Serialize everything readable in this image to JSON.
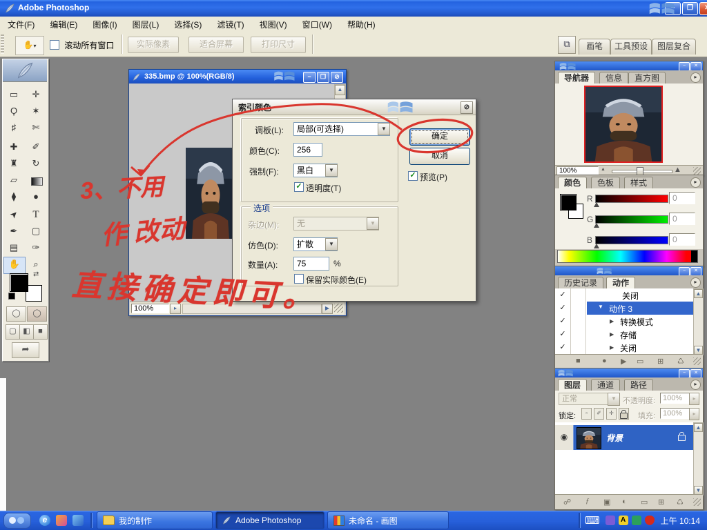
{
  "window": {
    "title": "Adobe Photoshop"
  },
  "menu_bar": {
    "items": [
      "文件(F)",
      "编辑(E)",
      "图像(I)",
      "图层(L)",
      "选择(S)",
      "滤镜(T)",
      "视图(V)",
      "窗口(W)",
      "帮助(H)"
    ]
  },
  "options_bar": {
    "scroll_all_windows_label": "滚动所有窗口",
    "actual_pixels_label": "实际像素",
    "fit_screen_label": "适合屏幕",
    "print_size_label": "打印尺寸",
    "palette_well_tabs": [
      "画笔",
      "工具预设",
      "图层复合"
    ]
  },
  "toolbox": {
    "tools": [
      {
        "name": "rectangular-marquee",
        "glyph": "▭"
      },
      {
        "name": "move",
        "glyph": "✛"
      },
      {
        "name": "lasso",
        "glyph": "Ϙ"
      },
      {
        "name": "magic-wand",
        "glyph": "✶"
      },
      {
        "name": "crop",
        "glyph": "♯"
      },
      {
        "name": "slice",
        "glyph": "✄"
      },
      {
        "name": "healing-brush",
        "glyph": "✚"
      },
      {
        "name": "brush",
        "glyph": "✐"
      },
      {
        "name": "clone-stamp",
        "glyph": "♜"
      },
      {
        "name": "history-brush",
        "glyph": "↻"
      },
      {
        "name": "eraser",
        "glyph": "▱"
      },
      {
        "name": "gradient",
        "glyph": ""
      },
      {
        "name": "blur",
        "glyph": "⧫"
      },
      {
        "name": "dodge",
        "glyph": "●"
      },
      {
        "name": "path-selection",
        "glyph": "➤"
      },
      {
        "name": "type",
        "glyph": "T"
      },
      {
        "name": "pen",
        "glyph": "✒"
      },
      {
        "name": "shape",
        "glyph": "▢"
      },
      {
        "name": "notes",
        "glyph": "▤"
      },
      {
        "name": "eyedropper",
        "glyph": "✑"
      },
      {
        "name": "hand",
        "glyph": "✋"
      },
      {
        "name": "zoom",
        "glyph": "⌕"
      }
    ]
  },
  "document_window": {
    "title": "335.bmp @ 100%(RGB/8)",
    "zoom_value": "100%"
  },
  "indexed_color_dialog": {
    "title": "索引颜色",
    "palette_label": "调板(L):",
    "palette_value": "局部(可选择)",
    "colors_label": "颜色(C):",
    "colors_value": "256",
    "forced_label": "强制(F):",
    "forced_value": "黑白",
    "transparency_label": "透明度(T)",
    "ok_label": "确定",
    "cancel_label": "取消",
    "preview_label": "预览(P)",
    "options_group_label": "选项",
    "matte_label": "杂边(M):",
    "matte_value": "无",
    "dither_label": "仿色(D):",
    "dither_value": "扩散",
    "amount_label": "数量(A):",
    "amount_value": "75",
    "amount_unit": "%",
    "preserve_colors_label": "保留实际颜色(E)"
  },
  "navigator_panel": {
    "tabs": [
      "导航器",
      "信息",
      "直方图"
    ],
    "zoom_value": "100%"
  },
  "color_panel": {
    "tabs": [
      "颜色",
      "色板",
      "样式"
    ],
    "r_label": "R",
    "g_label": "G",
    "b_label": "B",
    "r_value": "0",
    "g_value": "0",
    "b_value": "0"
  },
  "actions_panel": {
    "tabs": [
      "历史记录",
      "动作"
    ],
    "rows": [
      {
        "label": "关闭"
      },
      {
        "label": "动作 3"
      },
      {
        "label": "转换模式"
      },
      {
        "label": "存储"
      },
      {
        "label": "关闭"
      }
    ]
  },
  "layers_panel": {
    "tabs": [
      "图层",
      "通道",
      "路径"
    ],
    "blend_mode_value": "正常",
    "opacity_label": "不透明度:",
    "opacity_value": "100%",
    "lock_label": "锁定:",
    "fill_label": "填充:",
    "fill_value": "100%",
    "background_layer_name": "背景"
  },
  "annotations": {
    "step_line1": "3、不用",
    "step_line2": "作 改动",
    "step_line3": "直接确定即可。",
    "accent_color": "#d9362e"
  },
  "taskbar": {
    "task_buttons": [
      {
        "label": "我的制作"
      },
      {
        "label": "Adobe Photoshop"
      },
      {
        "label": "未命名 - 画图"
      }
    ],
    "clock": "上午 10:14"
  },
  "icons": {
    "hand": "✋",
    "dropdown_arrow": "▾",
    "combo_arrow": "▼",
    "minimize": "−",
    "maximize": "❐",
    "close": "✕",
    "close_slash": "⊘",
    "check": "✓",
    "menu_arrow": "▸",
    "expander_open": "▼",
    "expander_closed": "▶",
    "stop": "■",
    "record": "●",
    "play": "▶",
    "folder": "▭",
    "new_item": "⊞",
    "trash": "♺",
    "link": "☍",
    "layer_styles": "ƒ",
    "layer_mask": "▣",
    "adjustment": "◐",
    "eye": "◉",
    "keyboard": "⌨",
    "browser": "⧉",
    "spinner": "▸",
    "mountain_small": "▲",
    "mountain_large": "▲",
    "scroll_up": "▲",
    "scroll_down": "▼",
    "scroll_right": "▶",
    "swap_arrows": "⇄",
    "jump_imageready": "➦",
    "ie": "e",
    "screen_std": "▢",
    "screen_menu": "◧",
    "screen_full": "■",
    "mask_circle": "◯"
  }
}
